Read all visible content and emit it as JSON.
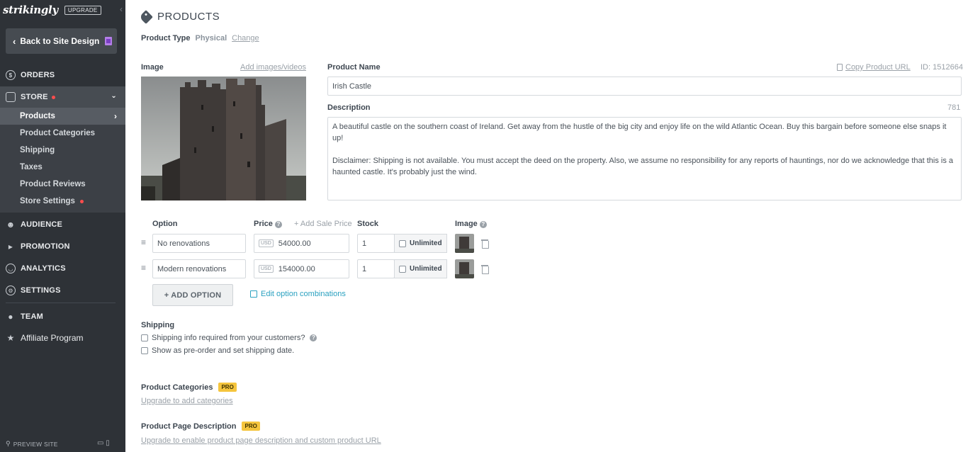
{
  "sidebar": {
    "logo": "strikingly",
    "upgrade": "UPGRADE",
    "back_label": "Back to Site Design",
    "nav": {
      "orders": "ORDERS",
      "store": "STORE",
      "audience": "AUDIENCE",
      "promotion": "PROMOTION",
      "analytics": "ANALYTICS",
      "settings": "SETTINGS",
      "team": "TEAM",
      "affiliate": "Affiliate Program"
    },
    "store_items": [
      "Products",
      "Product Categories",
      "Shipping",
      "Taxes",
      "Product Reviews",
      "Store Settings"
    ],
    "preview": "PREVIEW SITE"
  },
  "page": {
    "title": "PRODUCTS",
    "product_type_label": "Product Type",
    "product_type_value": "Physical",
    "change_link": "Change"
  },
  "product": {
    "image_label": "Image",
    "add_media": "Add images/videos",
    "name_label": "Product Name",
    "copy_url": "Copy Product URL",
    "id_text": "ID: 1512664",
    "name_value": "Irish Castle",
    "description_label": "Description",
    "description_count": "781",
    "description_p1": "A beautiful castle on the southern coast of Ireland. Get away from the hustle of the big city and enjoy life on the wild Atlantic Ocean. Buy this bargain before someone else snaps it up!",
    "description_p2": "Disclaimer: Shipping is not available. You must accept the deed on the property. Also, we assume no responsibility for any reports of hauntings, nor do we acknowledge that this is a haunted castle. It's probably just the wind."
  },
  "options_table": {
    "headers": {
      "option": "Option",
      "price": "Price",
      "sale": "+ Add Sale Price",
      "stock": "Stock",
      "image": "Image"
    },
    "currency": "USD",
    "unlimited_label": "Unlimited",
    "rows": [
      {
        "option": "No renovations",
        "price": "54000.00",
        "stock": "1"
      },
      {
        "option": "Modern renovations",
        "price": "154000.00",
        "stock": "1"
      }
    ],
    "add_option": "+ ADD OPTION",
    "edit_combinations": "Edit option combinations"
  },
  "shipping": {
    "label": "Shipping",
    "option1": "Shipping info required from your customers?",
    "option2": "Show as pre-order and set shipping date."
  },
  "categories": {
    "label": "Product Categories",
    "badge": "PRO",
    "link": "Upgrade to add categories"
  },
  "page_description": {
    "label": "Product Page Description",
    "badge": "PRO",
    "link": "Upgrade to enable product page description and custom product URL"
  }
}
